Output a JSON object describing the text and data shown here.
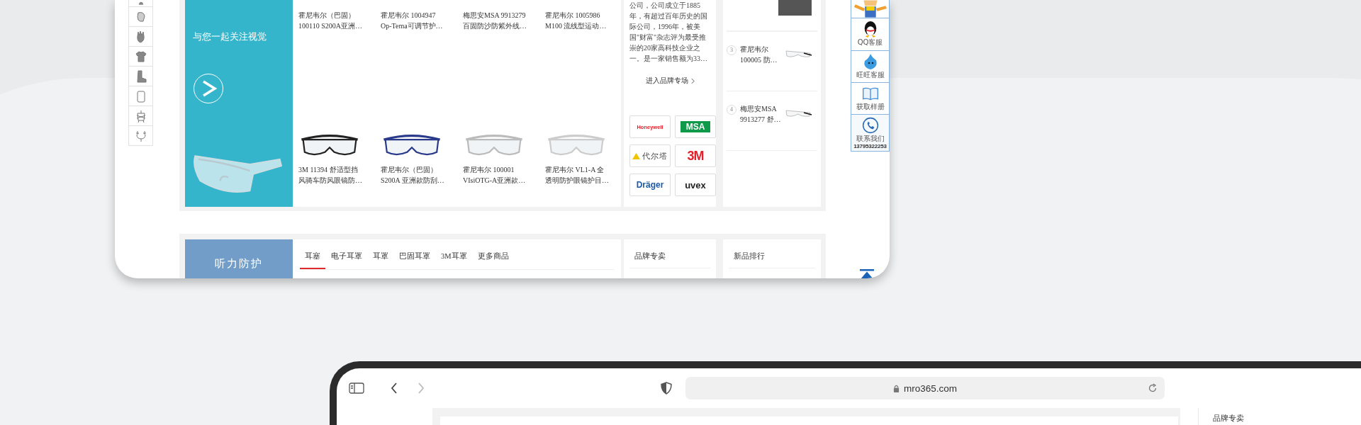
{
  "eyewear_section": {
    "banner_text": "与您一起关注视觉",
    "products": [
      {
        "title_lines": [
          "霍尼韦尔（巴固）",
          "100110 S200A亚洲…"
        ],
        "image": false
      },
      {
        "title_lines": [
          "霍尼韦尔 1004947",
          "Op-Tema可调节护…"
        ],
        "image": false
      },
      {
        "title_lines": [
          "梅思安MSA 9913279",
          "百固防沙防紫外线…"
        ],
        "image": false
      },
      {
        "title_lines": [
          "霍尼韦尔 1005986",
          "M100 流线型运动…"
        ],
        "image": false
      },
      {
        "title_lines": [
          "3M 11394 舒适型挡",
          "风骑车防风眼镜防…"
        ],
        "image": true
      },
      {
        "title_lines": [
          "霍尼韦尔（巴固）",
          "S200A 亚洲款防刮…"
        ],
        "image": true
      },
      {
        "title_lines": [
          "霍尼韦尔 100001",
          "VIsiOTG-A亚洲款…"
        ],
        "image": true
      },
      {
        "title_lines": [
          "霍尼韦尔 VL1-A 全",
          "透明防护眼镜护目…"
        ],
        "image": true
      }
    ],
    "brand": {
      "description_lines": [
        "公司，公司成立于1885",
        "年，有超过百年历史的国",
        "际公司，1996年，被美",
        "国\"财富\"杂志评为最受推",
        "崇的20家高科技企业之",
        "一。是一家销售额为33…"
      ],
      "link": "进入品牌专场",
      "logos": [
        {
          "kind": "wordmark",
          "text": "Honeywell",
          "color": "#e4202b"
        },
        {
          "kind": "badge",
          "text": "MSA",
          "color": "#0e9a48"
        },
        {
          "kind": "delta",
          "text": "代尔塔",
          "color": "#f2c400"
        },
        {
          "kind": "wordmark",
          "text": "3M",
          "color": "#e4202b"
        },
        {
          "kind": "wordmark",
          "text": "Dräger",
          "color": "#1c5aa6"
        },
        {
          "kind": "wordmark",
          "text": "uvex",
          "color": "#222222"
        }
      ]
    },
    "ranking": [
      {
        "rank": "3",
        "title_lines": [
          "霍尼韦尔",
          "100005 防…"
        ]
      },
      {
        "rank": "4",
        "title_lines": [
          "梅思安MSA",
          "9913277 舒…"
        ]
      }
    ]
  },
  "hearing_section": {
    "title": "听力防护",
    "tabs": [
      {
        "label": "耳塞",
        "selected": true
      },
      {
        "label": "电子耳罩",
        "selected": false
      },
      {
        "label": "耳罩",
        "selected": false
      },
      {
        "label": "巴固耳罩",
        "selected": false
      },
      {
        "label": "3M耳罩",
        "selected": false
      },
      {
        "label": "更多商品",
        "selected": false
      }
    ],
    "brand_heading": "品牌专卖",
    "ranking_heading": "新品排行"
  },
  "side_bar": [
    {
      "kind": "qq",
      "label": "QQ客服"
    },
    {
      "kind": "wangwang",
      "label": "旺旺客服"
    },
    {
      "kind": "book",
      "label": "获取样册"
    },
    {
      "kind": "phone",
      "label": "联系我们",
      "phone": "13795322253"
    }
  ],
  "browser": {
    "nav": [
      {
        "kind": "back",
        "disabled": false
      },
      {
        "kind": "forward",
        "disabled": true
      }
    ],
    "url": "mro365.com",
    "partial_heading": "品牌专卖"
  }
}
